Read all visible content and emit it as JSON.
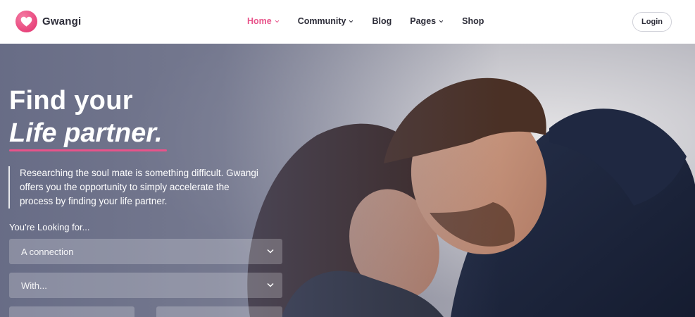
{
  "brand": {
    "name": "Gwangi",
    "logo_icon": "heart-icon",
    "accent_color": "#e8538a"
  },
  "nav": {
    "items": [
      {
        "label": "Home",
        "has_dropdown": true,
        "active": true
      },
      {
        "label": "Community",
        "has_dropdown": true,
        "active": false
      },
      {
        "label": "Blog",
        "has_dropdown": false,
        "active": false
      },
      {
        "label": "Pages",
        "has_dropdown": true,
        "active": false
      },
      {
        "label": "Shop",
        "has_dropdown": false,
        "active": false
      }
    ],
    "login_label": "Login"
  },
  "hero": {
    "title_line1": "Find your",
    "title_line2": "Life partner.",
    "description": "Researching the soul mate is something difficult. Gwangi offers you the opportunity to simply accelerate the process by finding your life partner.",
    "description_lines": [
      "Researching the soul mate is something difficult. Gwangi",
      "offers you the opportunity to simply accelerate the",
      "process by finding your life partner."
    ],
    "search": {
      "label": "You’re Looking for...",
      "select_1": "A connection",
      "select_2": "With..."
    }
  }
}
